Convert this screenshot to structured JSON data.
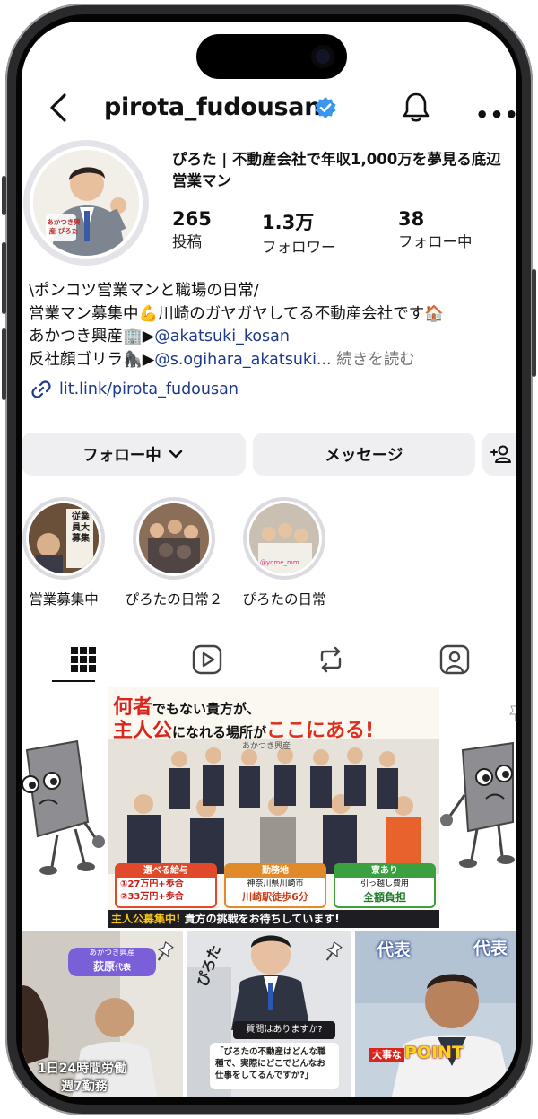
{
  "header": {
    "username": "pirota_fudousan",
    "verified_icon": "verified-badge-icon",
    "back_icon": "chevron-left-icon",
    "notifications_icon": "bell-icon",
    "more_label": "•••"
  },
  "profile": {
    "display_name": "ぴろた | 不動産会社で年収1,000万を夢見る底辺営業マン",
    "avatar_caption": "あかつき興産 ぴろた",
    "stats": [
      {
        "value": "265",
        "label": "投稿"
      },
      {
        "value": "1.3万",
        "label": "フォロワー"
      },
      {
        "value": "38",
        "label": "フォロー中"
      }
    ],
    "bio": {
      "line1": "\\ポンコツ営業マンと職場の日常/",
      "line2_a": "営業マン募集中💪川崎のガヤガヤしてる不動産会社です🏠",
      "line3_a": "あかつき興産🏢▶",
      "line3_mention": "@akatsuki_kosan",
      "line4_a": "反社顔ゴリラ🦍▶",
      "line4_mention": "@s.ogihara_akatsuki...",
      "more": " 続きを読む"
    },
    "link": "lit.link/pirota_fudousan"
  },
  "actions": {
    "following": "フォロー中",
    "message": "メッセージ",
    "add_user_icon": "add-person-icon"
  },
  "highlights": [
    {
      "label": "営業募集中",
      "thumb_text": "従業員大募集"
    },
    {
      "label": "ぴろたの日常２"
    },
    {
      "label": "ぴろたの日常",
      "thumb_text": "@yome_mm"
    }
  ],
  "tabs": [
    "grid-icon",
    "reels-icon",
    "reposts-icon",
    "tagged-icon"
  ],
  "posts": {
    "main": {
      "headline_a": "何者",
      "headline_b": "でもない貴方が、",
      "headline_c": "主人公",
      "headline_d": "になれる場所が",
      "headline_e": "ここにある!",
      "company": "あかつき興産",
      "boxes": [
        {
          "title": "選べる給与",
          "l1": "①27万円+歩合",
          "l2": "②33万円+歩合"
        },
        {
          "title": "勤務地",
          "l1": "神奈川県川崎市",
          "l2": "川崎駅徒歩6分"
        },
        {
          "title": "寮あり",
          "l1": "引っ越し費用",
          "l2": "全額負担"
        }
      ],
      "banner_a": "主人公募集中!",
      "banner_b": " 貴方の挑戦をお待ちしています!"
    },
    "row2": [
      {
        "badge_a": "あかつき興産",
        "badge_b": "荻原",
        "badge_c": "代表",
        "caption": "1日24時間労働",
        "caption2": "週7勤務"
      },
      {
        "tag": "ぴろた",
        "q_title": "質問はありますか?",
        "q_body": "「ぴろたの不動産はどんな職種で、実際にどこでどんなお仕事をしてるんですか?」"
      },
      {
        "tag_a": "代表",
        "tag_b": "代表",
        "point_a": "大事な",
        "point_b": "POINT"
      }
    ]
  }
}
